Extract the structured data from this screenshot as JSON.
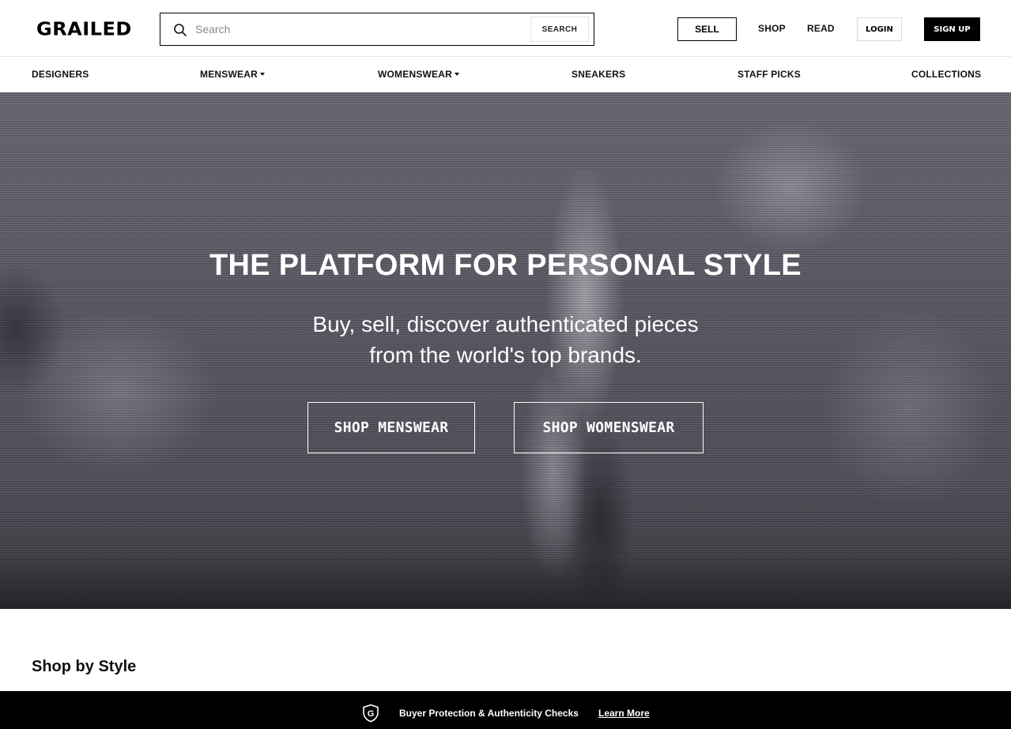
{
  "header": {
    "logo": "GRAILED",
    "search": {
      "placeholder": "Search",
      "button_label": "SEARCH"
    },
    "sell_label": "SELL",
    "shop_label": "SHOP",
    "read_label": "READ",
    "login_label": "LOGIN",
    "signup_label": "SIGN UP"
  },
  "categories": [
    {
      "label": "DESIGNERS",
      "has_dropdown": false
    },
    {
      "label": "MENSWEAR",
      "has_dropdown": true
    },
    {
      "label": "WOMENSWEAR",
      "has_dropdown": true
    },
    {
      "label": "SNEAKERS",
      "has_dropdown": false
    },
    {
      "label": "STAFF PICKS",
      "has_dropdown": false
    },
    {
      "label": "COLLECTIONS",
      "has_dropdown": false
    }
  ],
  "hero": {
    "title": "THE PLATFORM FOR PERSONAL STYLE",
    "subtitle_line1": "Buy, sell, discover authenticated pieces",
    "subtitle_line2": "from the world's top brands.",
    "button_menswear": "SHOP MENSWEAR",
    "button_womenswear": "SHOP WOMENSWEAR"
  },
  "section": {
    "title": "Shop by Style"
  },
  "banner": {
    "icon": "shield-g-icon",
    "text": "Buyer Protection & Authenticity Checks",
    "link": "Learn More"
  },
  "colors": {
    "accent": "#000000",
    "background": "#ffffff",
    "banner": "#000000"
  }
}
